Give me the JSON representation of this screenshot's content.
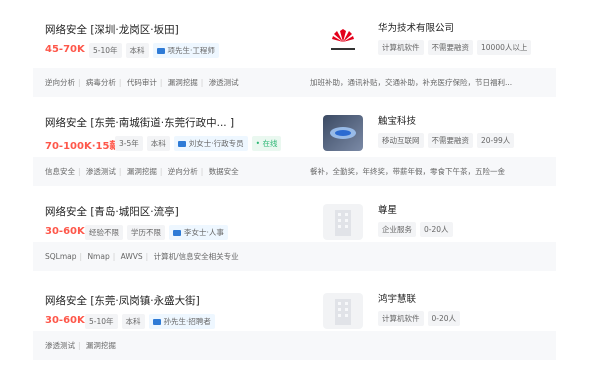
{
  "jobs": [
    {
      "title": "网络安全  [深圳·龙岗区·坂田]",
      "salary": "45-70K",
      "tags": [
        "5-10年",
        "本科"
      ],
      "recruiter": "项先生·工程师",
      "online": "",
      "company": "华为技术有限公司",
      "company_tags": [
        "计算机软件",
        "不需要融资",
        "10000人以上"
      ],
      "skills": [
        "逆向分析",
        "病毒分析",
        "代码审计",
        "漏洞挖掘",
        "渗透测试"
      ],
      "benefits": "加班补助，通讯补贴，交通补助，补充医疗保险，节日福利..."
    },
    {
      "title": "网络安全  [东莞·南城街道·东莞行政中...  ]",
      "salary": "70-100K·15薪",
      "tags": [
        "3-5年",
        "本科"
      ],
      "recruiter": "刘女士·行政专员",
      "online": "在线",
      "company": "触宝科技",
      "company_tags": [
        "移动互联网",
        "不需要融资",
        "20-99人"
      ],
      "skills": [
        "信息安全",
        "渗透测试",
        "漏洞挖掘",
        "逆向分析",
        "数据安全"
      ],
      "benefits": "餐补，全勤奖，年终奖，带薪年假，零食下午茶，五险一金"
    },
    {
      "title": "网络安全  [青岛·城阳区·流亭]",
      "salary": "30-60K",
      "tags": [
        "经验不限",
        "学历不限"
      ],
      "recruiter": "李女士·人事",
      "online": "",
      "company": "尊星",
      "company_tags": [
        "企业服务",
        "0-20人"
      ],
      "skills": [
        "SQLmap",
        "Nmap",
        "AWVS",
        "计算机/信息安全相关专业"
      ],
      "benefits": ""
    },
    {
      "title": "网络安全  [东莞·凤岗镇·永盛大街]",
      "salary": "30-60K",
      "tags": [
        "5-10年",
        "本科"
      ],
      "recruiter": "孙先生·招聘者",
      "online": "",
      "company": "鸿宇慧联",
      "company_tags": [
        "计算机软件",
        "0-20人"
      ],
      "skills": [
        "渗透测试",
        "漏洞挖掘"
      ],
      "benefits": ""
    }
  ],
  "colors": {
    "salary": "#fe574a",
    "online": "#2bb673",
    "recruiter_icon": "#2f7bd6"
  },
  "icons": {
    "logo1": "huawei-logo",
    "logo2": "chubao-logo",
    "logo3": "building-icon",
    "logo4": "building-icon"
  }
}
